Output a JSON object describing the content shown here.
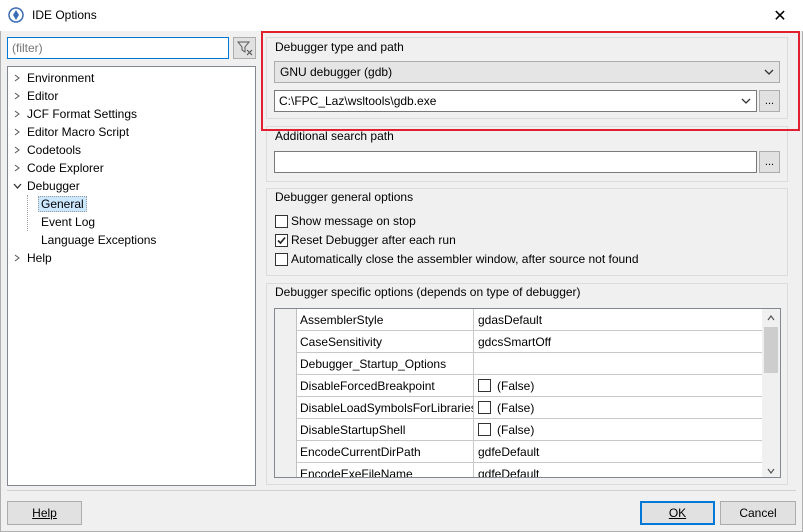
{
  "window": {
    "title": "IDE Options",
    "close_glyph": "✕"
  },
  "filter": {
    "placeholder": "(filter)"
  },
  "tree": {
    "items": [
      {
        "label": "Environment",
        "expanded": false
      },
      {
        "label": "Editor",
        "expanded": false
      },
      {
        "label": "JCF Format Settings",
        "expanded": false
      },
      {
        "label": "Editor Macro Script",
        "expanded": false
      },
      {
        "label": "Codetools",
        "expanded": false
      },
      {
        "label": "Code Explorer",
        "expanded": false
      },
      {
        "label": "Debugger",
        "expanded": true
      },
      {
        "label": "General",
        "selected": true
      },
      {
        "label": "Event Log"
      },
      {
        "label": "Language Exceptions"
      },
      {
        "label": "Help",
        "expanded": false
      }
    ]
  },
  "debugger_type": {
    "label": "Debugger type and path",
    "type_value": "GNU debugger (gdb)",
    "path_value": "C:\\FPC_Laz\\wsltools\\gdb.exe",
    "browse_label": "..."
  },
  "search_path": {
    "label": "Additional search path",
    "value": "",
    "browse_label": "..."
  },
  "general_options": {
    "label": "Debugger general options",
    "items": [
      {
        "label": "Show message on stop",
        "checked": false
      },
      {
        "label": "Reset Debugger after each run",
        "checked": true
      },
      {
        "label": "Automatically close the assembler window, after source not found",
        "checked": false
      }
    ]
  },
  "specific_options": {
    "label": "Debugger specific options (depends on type of debugger)",
    "rows": [
      {
        "name": "AssemblerStyle",
        "value": "gdasDefault",
        "checkbox": false
      },
      {
        "name": "CaseSensitivity",
        "value": "gdcsSmartOff",
        "checkbox": false
      },
      {
        "name": "Debugger_Startup_Options",
        "value": "",
        "checkbox": false
      },
      {
        "name": "DisableForcedBreakpoint",
        "value": "(False)",
        "checkbox": true
      },
      {
        "name": "DisableLoadSymbolsForLibraries",
        "value": "(False)",
        "checkbox": true
      },
      {
        "name": "DisableStartupShell",
        "value": "(False)",
        "checkbox": true
      },
      {
        "name": "EncodeCurrentDirPath",
        "value": "gdfeDefault",
        "checkbox": false
      },
      {
        "name": "EncodeExeFileName",
        "value": "gdfeDefault",
        "checkbox": false
      }
    ]
  },
  "buttons": {
    "help": "Help",
    "ok": "OK",
    "cancel": "Cancel"
  },
  "colors": {
    "highlight": "#e0202e",
    "selection": "#cce8ff",
    "focus": "#0078d7"
  }
}
